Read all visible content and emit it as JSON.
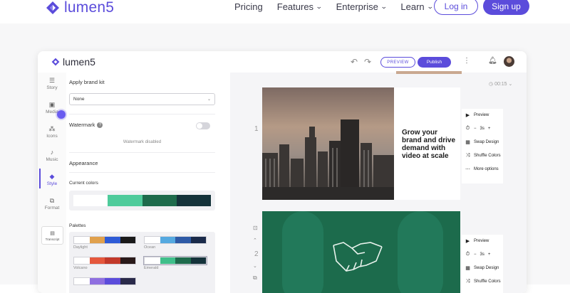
{
  "site": {
    "logo_text": "lumen5",
    "nav": [
      {
        "label": "Pricing",
        "has_dropdown": false
      },
      {
        "label": "Features",
        "has_dropdown": true
      },
      {
        "label": "Enterprise",
        "has_dropdown": true
      },
      {
        "label": "Learn",
        "has_dropdown": true
      }
    ],
    "login_label": "Log in",
    "signup_label": "Sign up",
    "brand_color": "#5b4cdb"
  },
  "app": {
    "logo_text": "lumen5",
    "preview_label": "PREVIEW",
    "publish_label": "Publish",
    "rail": [
      {
        "label": "Story",
        "icon": "document-icon"
      },
      {
        "label": "Media",
        "icon": "image-icon"
      },
      {
        "label": "Icons",
        "icon": "shapes-icon"
      },
      {
        "label": "Music",
        "icon": "music-note-icon"
      },
      {
        "label": "Style",
        "icon": "palette-icon",
        "active": true
      },
      {
        "label": "Format",
        "icon": "format-icon"
      }
    ],
    "transcript_label": "Transcript",
    "panel": {
      "brand_kit_label": "Apply brand kit",
      "brand_kit_value": "None",
      "watermark_label": "Watermark",
      "watermark_status": "Watermark disabled",
      "appearance_label": "Appearance",
      "current_colors_label": "Current colors",
      "current_colors": [
        "#ffffff",
        "#4ecb9b",
        "#1e6b4c",
        "#14323a"
      ],
      "palettes_label": "Palettes",
      "palettes": [
        {
          "name": "Daylight",
          "colors": [
            "#ffffff",
            "#e0a04c",
            "#2e5bd6",
            "#1a1a1a"
          ]
        },
        {
          "name": "Ocean",
          "colors": [
            "#ffffff",
            "#55a9e0",
            "#2e5aa6",
            "#1a2a4a"
          ]
        },
        {
          "name": "Volcano",
          "colors": [
            "#ffffff",
            "#e5573c",
            "#c2392a",
            "#2a1a1a"
          ]
        },
        {
          "name": "Emerald",
          "colors": [
            "#ffffff",
            "#3fbf8a",
            "#1e6b4c",
            "#14323a"
          ]
        },
        {
          "name": "",
          "colors": [
            "#ffffff",
            "#8f6fe0",
            "#5b4cdb",
            "#2a2a4a"
          ]
        }
      ]
    },
    "canvas": {
      "timer": "00:15",
      "scenes": [
        {
          "number": "1",
          "text": "Grow your brand and drive demand with video at scale"
        },
        {
          "number": "2",
          "text": ""
        }
      ],
      "options": {
        "preview": "Preview",
        "duration": "3s",
        "swap_design": "Swap Design",
        "shuffle_colors": "Shuffle Colors",
        "more_options": "More options"
      }
    }
  }
}
